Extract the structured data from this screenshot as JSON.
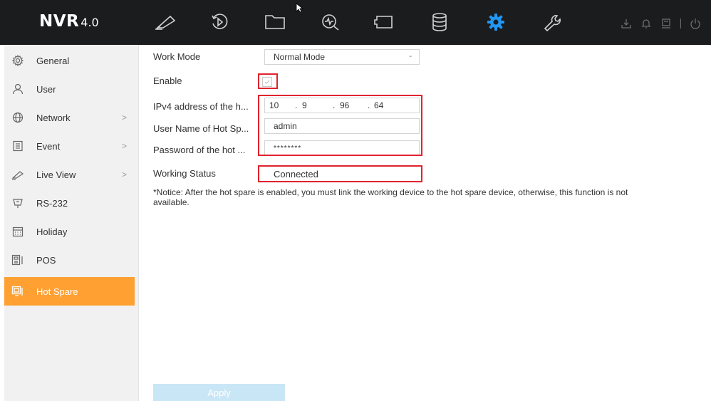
{
  "header": {
    "logo_main": "NVR",
    "logo_version": "4.0",
    "nav_icons": [
      "live-view-icon",
      "playback-icon",
      "file-management-icon",
      "smart-analysis-icon",
      "channel-icon",
      "storage-icon",
      "configuration-icon",
      "maintenance-icon"
    ],
    "active_nav": "configuration-icon",
    "active_color": "#2196f3",
    "right_icons": [
      "download-icon",
      "alarm-bell-icon",
      "screen-icon",
      "power-icon"
    ]
  },
  "sidebar": {
    "active_color": "#ffa033",
    "items": [
      {
        "label": "General",
        "icon": "gear-icon",
        "chevron": ""
      },
      {
        "label": "User",
        "icon": "user-icon",
        "chevron": ""
      },
      {
        "label": "Network",
        "icon": "globe-icon",
        "chevron": ">"
      },
      {
        "label": "Event",
        "icon": "event-icon",
        "chevron": ">"
      },
      {
        "label": "Live View",
        "icon": "camera-icon",
        "chevron": ">"
      },
      {
        "label": "RS-232",
        "icon": "rs232-icon",
        "chevron": ""
      },
      {
        "label": "Holiday",
        "icon": "calendar-icon",
        "chevron": ""
      },
      {
        "label": "POS",
        "icon": "pos-icon",
        "chevron": ""
      },
      {
        "label": "Hot Spare",
        "icon": "hot-spare-icon",
        "chevron": ""
      }
    ]
  },
  "form": {
    "work_mode_label": "Work Mode",
    "work_mode_value": "Normal Mode",
    "work_mode_caret": "-",
    "enable_label": "Enable",
    "enable_checked": true,
    "ipv4_label": "IPv4 address of the h...",
    "ipv4_octets": [
      "10",
      "9",
      "96",
      "64"
    ],
    "ipv4_dot": ".",
    "username_label": "User Name of Hot Sp...",
    "username_value": "admin",
    "password_label": "Password of the hot ...",
    "password_value": "********",
    "status_label": "Working Status",
    "status_value": "Connected",
    "highlight_color": "#e0232e"
  },
  "notice": "*Notice: After the hot spare is enabled, you must link the working device to the hot spare device, otherwise, this function is not available.",
  "apply_label": "Apply"
}
